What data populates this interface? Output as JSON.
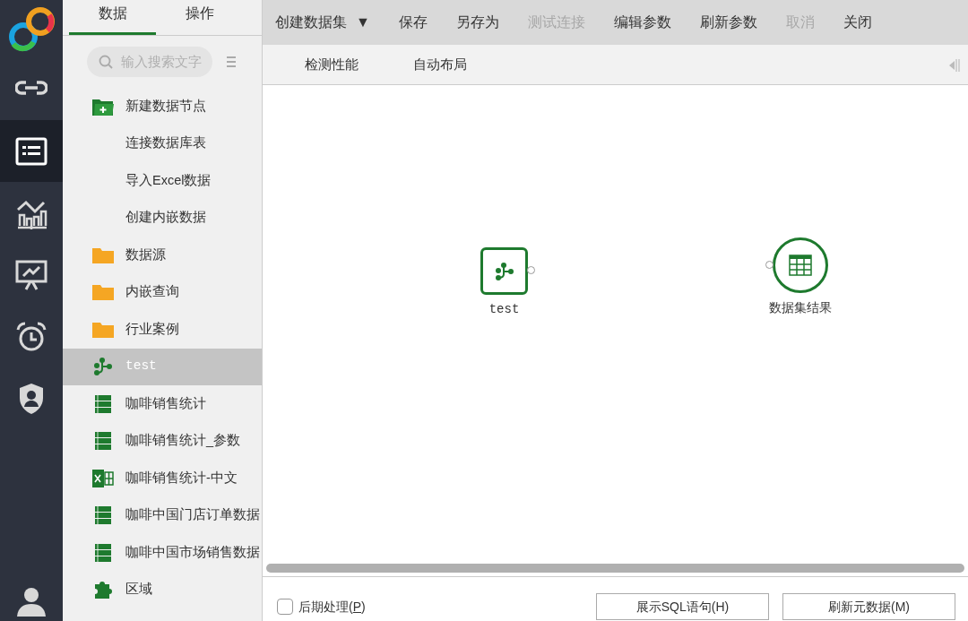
{
  "rail": {
    "items": [
      {
        "kind": "link",
        "selected": false
      },
      {
        "kind": "list",
        "selected": true
      },
      {
        "kind": "chart",
        "selected": false
      },
      {
        "kind": "screen",
        "selected": false
      },
      {
        "kind": "alarm",
        "selected": false
      },
      {
        "kind": "shield",
        "selected": false
      }
    ]
  },
  "sidebar": {
    "tabs": [
      {
        "label": "数据",
        "selected": true
      },
      {
        "label": "操作",
        "selected": false
      }
    ],
    "search": {
      "placeholder": "输入搜索文字"
    },
    "items": [
      {
        "kind": "new-folder",
        "label": "新建数据节点",
        "selected": false
      },
      {
        "kind": "none",
        "label": "连接数据库表",
        "selected": false
      },
      {
        "kind": "none",
        "label": "导入Excel数据",
        "selected": false
      },
      {
        "kind": "none",
        "label": "创建内嵌数据",
        "selected": false
      },
      {
        "kind": "folder",
        "label": "数据源",
        "selected": false
      },
      {
        "kind": "folder",
        "label": "内嵌查询",
        "selected": false
      },
      {
        "kind": "folder",
        "label": "行业案例",
        "selected": false
      },
      {
        "kind": "flow",
        "label": "test",
        "selected": true
      },
      {
        "kind": "table",
        "label": "咖啡销售统计",
        "selected": false
      },
      {
        "kind": "table",
        "label": "咖啡销售统计_参数",
        "selected": false
      },
      {
        "kind": "excel",
        "label": "咖啡销售统计-中文",
        "selected": false
      },
      {
        "kind": "table",
        "label": "咖啡中国门店订单数据",
        "selected": false
      },
      {
        "kind": "table",
        "label": "咖啡中国市场销售数据",
        "selected": false
      },
      {
        "kind": "puzzle",
        "label": "区域",
        "selected": false
      }
    ]
  },
  "toolbar": {
    "items": [
      {
        "label": "创建数据集",
        "caret": "▼",
        "disabled": false
      },
      {
        "label": "保存",
        "disabled": false
      },
      {
        "label": "另存为",
        "disabled": false
      },
      {
        "label": "测试连接",
        "disabled": true
      },
      {
        "label": "编辑参数",
        "disabled": false
      },
      {
        "label": "刷新参数",
        "disabled": false
      },
      {
        "label": "取消",
        "disabled": true
      },
      {
        "label": "关闭",
        "disabled": false
      }
    ]
  },
  "subtoolbar": {
    "items": [
      "检测性能",
      "自动布局"
    ]
  },
  "canvas": {
    "nodes": [
      {
        "kind": "flow",
        "label": "test"
      },
      {
        "kind": "result",
        "label": "数据集结果"
      }
    ]
  },
  "footer": {
    "checkbox": {
      "label": "后期处理(",
      "mnemonic": "P",
      "suffix": ")",
      "checked": false
    },
    "buttons": [
      "展示SQL语句(H)",
      "刷新元数据(M)"
    ]
  }
}
